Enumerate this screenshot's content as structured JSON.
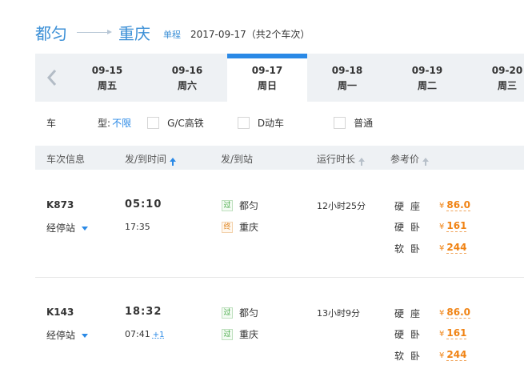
{
  "route": {
    "from": "都匀",
    "to": "重庆",
    "trip_type": "单程",
    "summary": "2017-09-17（共2个车次）"
  },
  "dates": {
    "prev_icon": "chevron-left-icon",
    "items": [
      {
        "date": "09-15",
        "weekday": "周五",
        "active": false
      },
      {
        "date": "09-16",
        "weekday": "周六",
        "active": false
      },
      {
        "date": "09-17",
        "weekday": "周日",
        "active": true
      },
      {
        "date": "09-18",
        "weekday": "周一",
        "active": false
      },
      {
        "date": "09-19",
        "weekday": "周二",
        "active": false
      },
      {
        "date": "09-20",
        "weekday": "周三",
        "active": false
      }
    ]
  },
  "filter": {
    "label_part1": "车",
    "label_part2": "型:",
    "all_link": "不限",
    "options": [
      "G/C高铁",
      "D动车",
      "普通"
    ]
  },
  "table": {
    "headers": [
      "车次信息",
      "发/到时间",
      "发/到站",
      "运行时长",
      "参考价"
    ],
    "rows": [
      {
        "train_no": "K873",
        "stops_label": "经停站",
        "dep_time": "05:10",
        "arr_time": "17:35",
        "arr_plus": "",
        "dep_badge": "过",
        "dep_station": "都匀",
        "arr_badge": "终",
        "arr_station": "重庆",
        "duration": "12小时25分",
        "seats": [
          {
            "type": "硬座",
            "price": "86.0"
          },
          {
            "type": "硬卧",
            "price": "161"
          },
          {
            "type": "软卧",
            "price": "244"
          }
        ]
      },
      {
        "train_no": "K143",
        "stops_label": "经停站",
        "dep_time": "18:32",
        "arr_time": "07:41",
        "arr_plus": "+1",
        "dep_badge": "过",
        "dep_station": "都匀",
        "arr_badge": "过",
        "arr_station": "重庆",
        "duration": "13小时9分",
        "seats": [
          {
            "type": "硬座",
            "price": "86.0"
          },
          {
            "type": "硬卧",
            "price": "161"
          },
          {
            "type": "软卧",
            "price": "244"
          }
        ]
      }
    ]
  },
  "currency_symbol": "¥",
  "colors": {
    "accent": "#2a89e6",
    "price": "#f08314",
    "date_bar": "#eef1f4"
  }
}
